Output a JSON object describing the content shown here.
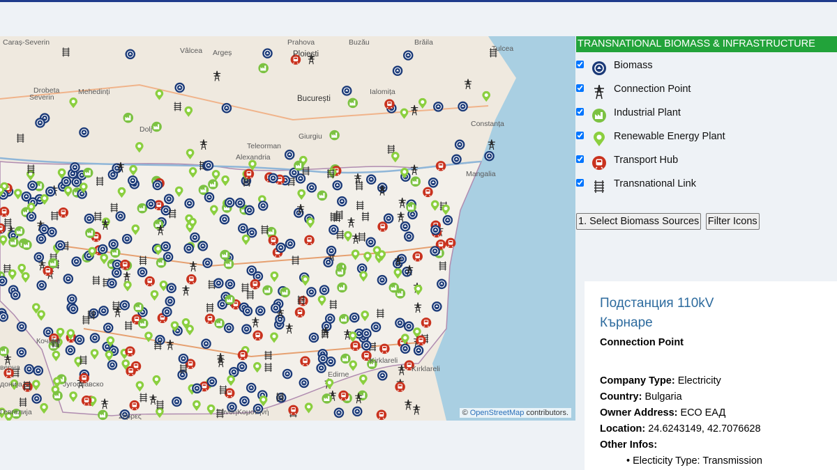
{
  "panel": {
    "title": "TRANSNATIONAL BIOMASS & INFRASTRUCTURE",
    "legend": [
      {
        "label": "Biomass",
        "icon": "biomass-icon",
        "checked": true
      },
      {
        "label": "Connection Point",
        "icon": "connection-point-icon",
        "checked": true
      },
      {
        "label": "Industrial Plant",
        "icon": "industrial-plant-icon",
        "checked": true
      },
      {
        "label": "Renewable Energy Plant",
        "icon": "renewable-energy-plant-icon",
        "checked": true
      },
      {
        "label": "Transport Hub",
        "icon": "transport-hub-icon",
        "checked": true
      },
      {
        "label": "Transnational Link",
        "icon": "transnational-link-icon",
        "checked": true
      }
    ],
    "buttons": {
      "select_biomass": "1. Select Biomass Sources",
      "filter_icons": "Filter Icons"
    }
  },
  "info": {
    "name": "Подстанция 110kV Кърнаре",
    "type": "Connection Point",
    "company_type_label": "Company Type:",
    "company_type": "Electricity",
    "country_label": "Country:",
    "country": "Bulgaria",
    "owner_label": "Owner Address:",
    "owner": "ЕСО ЕАД",
    "location_label": "Location:",
    "location": "24.6243149, 42.7076628",
    "other_label": "Other Infos:",
    "other_items": [
      "Electicity Type: Transmission"
    ]
  },
  "map": {
    "attribution_prefix": "©",
    "attribution_link": "OpenStreetMap",
    "attribution_suffix": "contributors.",
    "labels": [
      "Caraș-Severin",
      "Vâlcea",
      "Argeș",
      "Prahova",
      "Buzău",
      "Brăila",
      "Tulcea",
      "Ploiești",
      "Drobeta",
      "Mehedinți",
      "Severin",
      "București",
      "Ialomița",
      "Dolj",
      "Teleorman",
      "Giurgiu",
      "Constanța",
      "Alexandria",
      "Mangalia",
      "Kirklareli",
      "Kırklareli",
      "Edirne",
      "Кочани",
      "Југославско",
      "Ξάνθη",
      "Κομοτηνή",
      "Σέρρες",
      "Гевгелија",
      "дониja",
      "верна"
    ],
    "colors": {
      "biomass": "#1b3a78",
      "connection": "#222222",
      "industrial": "#7cc242",
      "renewable": "#8bcf3f",
      "transport": "#c9321e",
      "sea": "#a9cfe2",
      "land": "#efe9df",
      "bulgaria": "#f3f0ea"
    }
  }
}
